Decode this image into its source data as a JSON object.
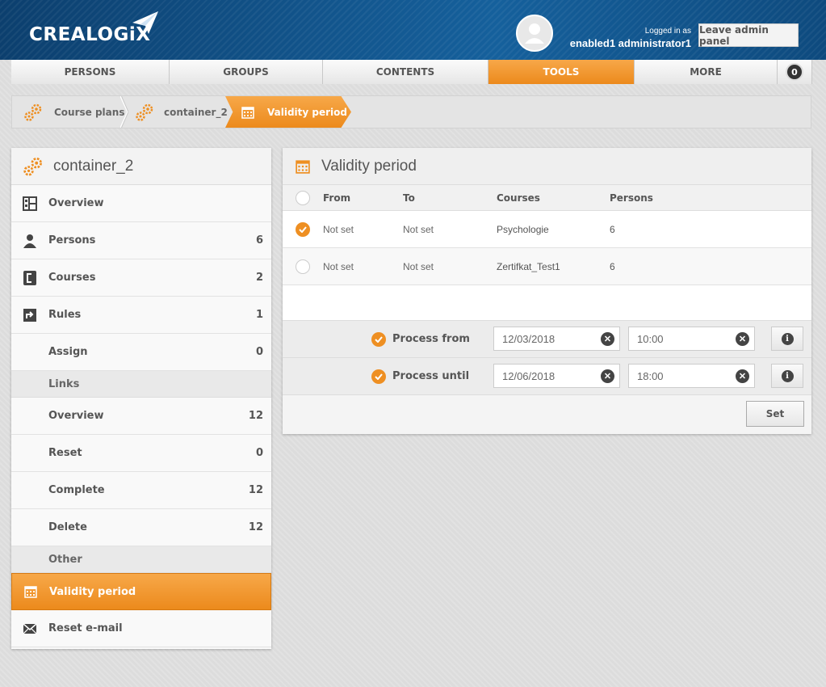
{
  "brand": {
    "name": "CREALOGiX",
    "accent": "#ee8f22",
    "header_bg": "#0f4f85"
  },
  "user": {
    "logged_label": "Logged in as",
    "name": "enabled1 administrator1",
    "leave_label": "Leave admin panel",
    "avatar_icon": "user-avatar-icon"
  },
  "nav": {
    "tabs": [
      {
        "label": "PERSONS"
      },
      {
        "label": "GROUPS"
      },
      {
        "label": "CONTENTS"
      },
      {
        "label": "TOOLS",
        "active": true
      },
      {
        "label": "MORE"
      }
    ],
    "notifications": "0"
  },
  "breadcrumb": {
    "items": [
      {
        "label": "Course plans",
        "icon": "gears-icon"
      },
      {
        "label": "container_2",
        "icon": "gears-icon"
      }
    ],
    "current": {
      "label": "Validity period",
      "icon": "calendar-icon"
    }
  },
  "sidebar": {
    "title": "container_2",
    "items": [
      {
        "label": "Overview",
        "count": "",
        "icon": "layout-icon"
      },
      {
        "label": "Persons",
        "count": "6",
        "icon": "person-icon"
      },
      {
        "label": "Courses",
        "count": "2",
        "icon": "course-icon"
      },
      {
        "label": "Rules",
        "count": "1",
        "icon": "rules-icon"
      },
      {
        "label": "Assign",
        "count": "0"
      }
    ],
    "group_links": "Links",
    "link_items": [
      {
        "label": "Overview",
        "count": "12"
      },
      {
        "label": "Reset",
        "count": "0"
      },
      {
        "label": "Complete",
        "count": "12"
      },
      {
        "label": "Delete",
        "count": "12"
      }
    ],
    "group_other": "Other",
    "other_items": [
      {
        "label": "Validity period",
        "icon": "calendar-icon",
        "active": true
      },
      {
        "label": "Reset e-mail",
        "icon": "envelope-icon"
      }
    ]
  },
  "panel": {
    "title": "Validity period",
    "columns": {
      "from": "From",
      "to": "To",
      "courses": "Courses",
      "persons": "Persons"
    },
    "rows": [
      {
        "checked": true,
        "from": "Not set",
        "to": "Not set",
        "course": "Psychologie",
        "persons": "6"
      },
      {
        "checked": false,
        "from": "Not set",
        "to": "Not set",
        "course": "Zertifkat_Test1",
        "persons": "6"
      }
    ],
    "process_from": {
      "label": "Process from",
      "date": "12/03/2018",
      "time": "10:00"
    },
    "process_until": {
      "label": "Process until",
      "date": "12/06/2018",
      "time": "18:00"
    },
    "set_label": "Set"
  }
}
